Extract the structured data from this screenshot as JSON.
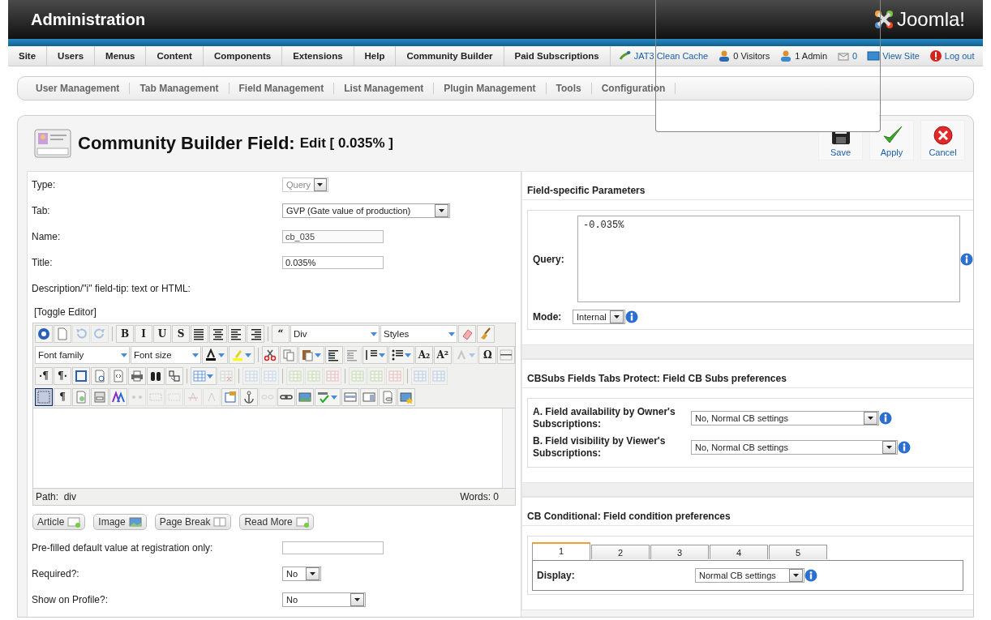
{
  "header": {
    "title": "Administration",
    "logo_text": "Joomla!"
  },
  "menu": [
    {
      "label": "Site"
    },
    {
      "label": "Users"
    },
    {
      "label": "Menus"
    },
    {
      "label": "Content"
    },
    {
      "label": "Components"
    },
    {
      "label": "Extensions"
    },
    {
      "label": "Help"
    },
    {
      "label": "Community Builder"
    },
    {
      "label": "Paid Subscriptions"
    }
  ],
  "status_items": [
    {
      "text": "JAT3 Clean Cache",
      "kind": "link"
    },
    {
      "text": "0 Visitors",
      "kind": "text"
    },
    {
      "text": "1 Admin",
      "kind": "text"
    },
    {
      "text": "0",
      "kind": "link"
    },
    {
      "text": "View Site",
      "kind": "link"
    },
    {
      "text": "Log out",
      "kind": "link"
    }
  ],
  "submenu": [
    {
      "label": "User Management"
    },
    {
      "label": "Tab Management"
    },
    {
      "label": "Field Management"
    },
    {
      "label": "List Management"
    },
    {
      "label": "Plugin Management"
    },
    {
      "label": "Tools"
    },
    {
      "label": "Configuration"
    }
  ],
  "page_title": {
    "main": "Community Builder Field:",
    "sub": "Edit [ 0.035% ]"
  },
  "actions": [
    {
      "label": "Save",
      "kind": "save"
    },
    {
      "label": "Apply",
      "kind": "apply"
    },
    {
      "label": "Cancel",
      "kind": "cancel"
    }
  ],
  "form_top": [
    {
      "label": "Type:",
      "kind": "select",
      "value": "Query",
      "disabled": true
    },
    {
      "label": "Tab:",
      "kind": "select",
      "value": "GVP (Gate value of production)",
      "disabled": false
    },
    {
      "label": "Name:",
      "kind": "input",
      "value": "cb_035",
      "disabled": true
    },
    {
      "label": "Title:",
      "kind": "input",
      "value": "0.035%",
      "disabled": false
    },
    {
      "label": "Description/\"i\" field-tip: text or HTML:",
      "kind": "label"
    }
  ],
  "toggle_editor": "[Toggle Editor]",
  "editor_toolbar": [
    [
      {
        "kind": "icon",
        "disabled": false
      },
      {
        "kind": "icon",
        "disabled": false
      },
      {
        "kind": "icon",
        "disabled": true
      },
      {
        "kind": "icon",
        "disabled": true
      },
      {
        "kind": "separator"
      },
      {
        "kind": "glyph",
        "glyph": "B",
        "disabled": false
      },
      {
        "kind": "glyph",
        "glyph": "I",
        "disabled": false
      },
      {
        "kind": "glyph",
        "glyph": "U",
        "disabled": false
      },
      {
        "kind": "glyph",
        "glyph": "S",
        "disabled": false
      },
      {
        "kind": "icon",
        "disabled": false
      },
      {
        "kind": "icon",
        "disabled": false
      },
      {
        "kind": "icon",
        "disabled": false
      },
      {
        "kind": "icon",
        "disabled": false
      },
      {
        "kind": "separator"
      },
      {
        "kind": "glyph",
        "glyph": "“",
        "disabled": false
      },
      {
        "kind": "select",
        "value": "Div"
      },
      {
        "kind": "select",
        "value": "Styles"
      },
      {
        "kind": "icon",
        "disabled": false
      },
      {
        "kind": "icon",
        "disabled": false
      }
    ],
    [
      {
        "kind": "select",
        "value": "Font family"
      },
      {
        "kind": "select",
        "value": "Font size"
      },
      {
        "kind": "icon",
        "disabled": false,
        "split": true
      },
      {
        "kind": "icon",
        "disabled": false,
        "split": true
      },
      {
        "kind": "separator"
      },
      {
        "kind": "icon",
        "disabled": false
      },
      {
        "kind": "icon",
        "disabled": false
      },
      {
        "kind": "icon",
        "disabled": false,
        "split": true
      },
      {
        "kind": "icon",
        "disabled": false
      },
      {
        "kind": "icon",
        "disabled": true
      },
      {
        "kind": "icon",
        "disabled": false,
        "split": true
      },
      {
        "kind": "icon",
        "disabled": false,
        "split": true
      },
      {
        "kind": "glyph",
        "glyph": "A₂",
        "disabled": false
      },
      {
        "kind": "glyph",
        "glyph": "A²",
        "disabled": false
      },
      {
        "kind": "icon",
        "disabled": true,
        "split": true
      },
      {
        "kind": "glyph",
        "glyph": "Ω",
        "disabled": false
      },
      {
        "kind": "icon",
        "disabled": false
      }
    ],
    [
      {
        "kind": "glyph",
        "glyph": "·¶",
        "disabled": false
      },
      {
        "kind": "glyph",
        "glyph": "¶·",
        "disabled": false
      },
      {
        "kind": "icon",
        "disabled": false
      },
      {
        "kind": "icon",
        "disabled": false
      },
      {
        "kind": "icon",
        "disabled": false
      },
      {
        "kind": "icon",
        "disabled": false
      },
      {
        "kind": "icon",
        "disabled": false
      },
      {
        "kind": "icon",
        "disabled": false
      },
      {
        "kind": "separator"
      },
      {
        "kind": "icon",
        "disabled": false,
        "split": true
      },
      {
        "kind": "icon",
        "disabled": true
      },
      {
        "kind": "separator"
      },
      {
        "kind": "icon",
        "disabled": true
      },
      {
        "kind": "icon",
        "disabled": true
      },
      {
        "kind": "separator"
      },
      {
        "kind": "icon",
        "disabled": true
      },
      {
        "kind": "icon",
        "disabled": true
      },
      {
        "kind": "icon",
        "disabled": true
      },
      {
        "kind": "separator"
      },
      {
        "kind": "icon",
        "disabled": true
      },
      {
        "kind": "icon",
        "disabled": true
      },
      {
        "kind": "icon",
        "disabled": true
      },
      {
        "kind": "separator"
      },
      {
        "kind": "icon",
        "disabled": true
      },
      {
        "kind": "icon",
        "disabled": true
      }
    ],
    [
      {
        "kind": "icon",
        "disabled": false,
        "selected": true
      },
      {
        "kind": "glyph",
        "glyph": "¶",
        "disabled": false
      },
      {
        "kind": "icon",
        "disabled": false
      },
      {
        "kind": "icon",
        "disabled": false
      },
      {
        "kind": "icon",
        "disabled": false
      },
      {
        "kind": "icon",
        "disabled": true
      },
      {
        "kind": "icon",
        "disabled": true
      },
      {
        "kind": "icon",
        "disabled": true
      },
      {
        "kind": "icon",
        "disabled": true
      },
      {
        "kind": "icon",
        "disabled": true
      },
      {
        "kind": "icon",
        "disabled": false
      },
      {
        "kind": "icon",
        "disabled": false
      },
      {
        "kind": "icon",
        "disabled": true
      },
      {
        "kind": "icon",
        "disabled": false
      },
      {
        "kind": "icon",
        "disabled": false
      },
      {
        "kind": "icon",
        "disabled": false,
        "split": true
      },
      {
        "kind": "icon",
        "disabled": false
      },
      {
        "kind": "icon",
        "disabled": false
      },
      {
        "kind": "icon",
        "disabled": false
      },
      {
        "kind": "icon",
        "disabled": false
      }
    ]
  ],
  "editor_status": {
    "path_label": "Path:",
    "path": "div",
    "words": "Words: 0"
  },
  "editor_buttons": [
    {
      "label": "Article"
    },
    {
      "label": "Image"
    },
    {
      "label": "Page Break"
    },
    {
      "label": "Read More"
    }
  ],
  "form_bottom": [
    {
      "label": "Pre-filled default value at registration only:",
      "kind": "input"
    },
    {
      "label": "Required?:",
      "kind": "select",
      "value": "No"
    },
    {
      "label": "Show on Profile?:",
      "kind": "select",
      "value": "No"
    }
  ],
  "sections": [
    {
      "title": "Field-specific Parameters",
      "kind": "query",
      "query_label": "Query:",
      "query": "-0.035%",
      "mode_label": "Mode:",
      "mode": "Internal"
    },
    {
      "title": "CBSubs Fields Tabs Protect: Field CB Subs preferences",
      "kind": "rows",
      "rows": [
        {
          "label": "A. Field availability by Owner's Subscriptions:",
          "value": "No, Normal CB settings"
        },
        {
          "label": "B. Field visibility by Viewer's Subscriptions:",
          "value": "No, Normal CB settings"
        }
      ]
    },
    {
      "title": "CB Conditional: Field condition preferences",
      "kind": "tabs",
      "tabs": [
        {
          "label": "1",
          "selected": true
        },
        {
          "label": "2",
          "selected": false
        },
        {
          "label": "3",
          "selected": false
        },
        {
          "label": "4",
          "selected": false
        },
        {
          "label": "5",
          "selected": false
        }
      ],
      "display_label": "Display:",
      "display": "Normal CB settings"
    }
  ]
}
